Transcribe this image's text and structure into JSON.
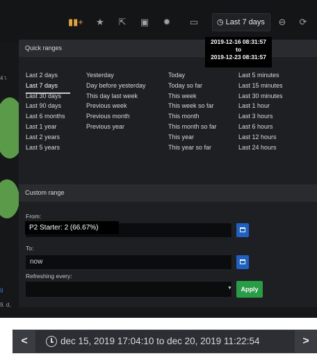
{
  "toolbar": {
    "time_button_label": "Last 7 days",
    "icons": [
      "add-panel-icon",
      "star-icon",
      "share-icon",
      "save-icon",
      "gear-icon",
      "tv-icon",
      "clock-icon",
      "zoom-out-icon",
      "refresh-icon"
    ]
  },
  "tooltip": {
    "from": "2019-12-16 08:31:57",
    "to_word": "to",
    "to": "2019-12-23 08:31:57"
  },
  "quick_ranges": {
    "title": "Quick ranges",
    "columns": [
      [
        "Last 2 days",
        "Last 7 days",
        "Last 30 days",
        "Last 90 days",
        "Last 6 months",
        "Last 1 year",
        "Last 2 years",
        "Last 5 years"
      ],
      [
        "Yesterday",
        "Day before yesterday",
        "This day last week",
        "Previous week",
        "Previous month",
        "Previous year"
      ],
      [
        "Today",
        "Today so far",
        "This week",
        "This week so far",
        "This month",
        "This month so far",
        "This year",
        "This year so far"
      ],
      [
        "Last 5 minutes",
        "Last 15 minutes",
        "Last 30 minutes",
        "Last 1 hour",
        "Last 3 hours",
        "Last 6 hours",
        "Last 12 hours",
        "Last 24 hours"
      ]
    ],
    "active": "Last 7 days"
  },
  "custom_range": {
    "title": "Custom range",
    "from_label": "From:",
    "to_label": "To:",
    "to_value": "now",
    "refresh_label": "Refreshing every:",
    "apply_label": "Apply"
  },
  "hover_tooltip": "P2 Starter: 2 (66.67%)",
  "background_fragments": {
    "left_a": "4 \\",
    "left_b": "g",
    "left_c": "9. d,"
  },
  "time_bar": {
    "range": "dec 15, 2019 17:04:10 to dec 20, 2019 11:22:54",
    "prev": "<",
    "next": ">"
  },
  "colors": {
    "panel_bg": "#161719",
    "dropdown_bg": "#1e1f22",
    "calendar_button": "#1f60c4",
    "apply_button": "#299c46",
    "accent_green": "#5a9b4a"
  }
}
